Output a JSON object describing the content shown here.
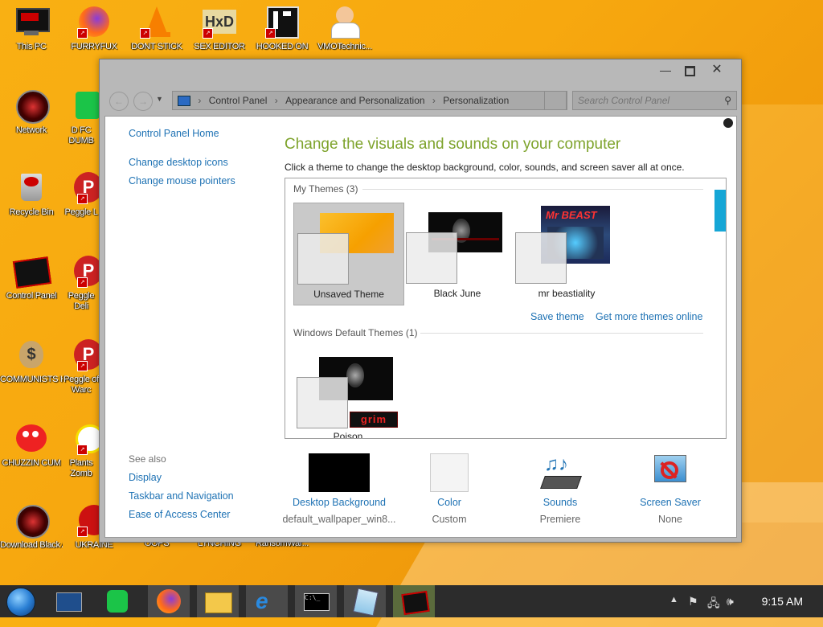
{
  "desktop": {
    "icons": [
      {
        "label": "This PC"
      },
      {
        "label": "FURRYFUX"
      },
      {
        "label": "DONT STICK"
      },
      {
        "label": "SEX EDITOR"
      },
      {
        "label": "HOOKED ON"
      },
      {
        "label": "VMOTechnic..."
      },
      {
        "label": "Network"
      },
      {
        "label": "D FC DUMB"
      },
      {
        "label": "Recycle Bin"
      },
      {
        "label": "Peggle L"
      },
      {
        "label": "Control Panel"
      },
      {
        "label": "Peggle Deli"
      },
      {
        "label": "COMMUNISTS HATE THIS G..."
      },
      {
        "label": "Peggle of Warc"
      },
      {
        "label": "CHUZZIN CUM"
      },
      {
        "label": "Plants Zomb"
      },
      {
        "label": "Download Black All..."
      },
      {
        "label": "UKRAINE"
      },
      {
        "label": "OOPS"
      },
      {
        "label": "LYNCHING"
      },
      {
        "label": "RansomWar..."
      }
    ]
  },
  "window": {
    "breadcrumb": [
      "Control Panel",
      "Appearance and Personalization",
      "Personalization"
    ],
    "search_placeholder": "Search Control Panel",
    "sidebar": {
      "home": "Control Panel Home",
      "links": [
        "Change desktop icons",
        "Change mouse pointers"
      ],
      "see_also_label": "See also",
      "see_also": [
        "Display",
        "Taskbar and Navigation",
        "Ease of Access Center"
      ]
    },
    "heading": "Change the visuals and sounds on your computer",
    "subheading": "Click a theme to change the desktop background, color, sounds, and screen saver all at once.",
    "my_themes_label": "My Themes (3)",
    "themes": [
      {
        "name": "Unsaved Theme"
      },
      {
        "name": "Black June"
      },
      {
        "name": "mr beastiality"
      }
    ],
    "save_theme": "Save theme",
    "get_more": "Get more themes online",
    "default_themes_label": "Windows Default Themes (1)",
    "default_theme": {
      "name": "Poison",
      "logo_text": "grim"
    },
    "beast_text": "Mr BEAST",
    "bottom": [
      {
        "label": "Desktop Background",
        "value": "default_wallpaper_win8..."
      },
      {
        "label": "Color",
        "value": "Custom"
      },
      {
        "label": "Sounds",
        "value": "Premiere"
      },
      {
        "label": "Screen Saver",
        "value": "None"
      }
    ]
  },
  "taskbar": {
    "clock": "9:15 AM"
  },
  "colors": {
    "accent_green": "#7ea32c",
    "link_blue": "#1e72b4",
    "scroll_blue": "#16a6d6",
    "desktop_orange": "#f7a80f"
  }
}
